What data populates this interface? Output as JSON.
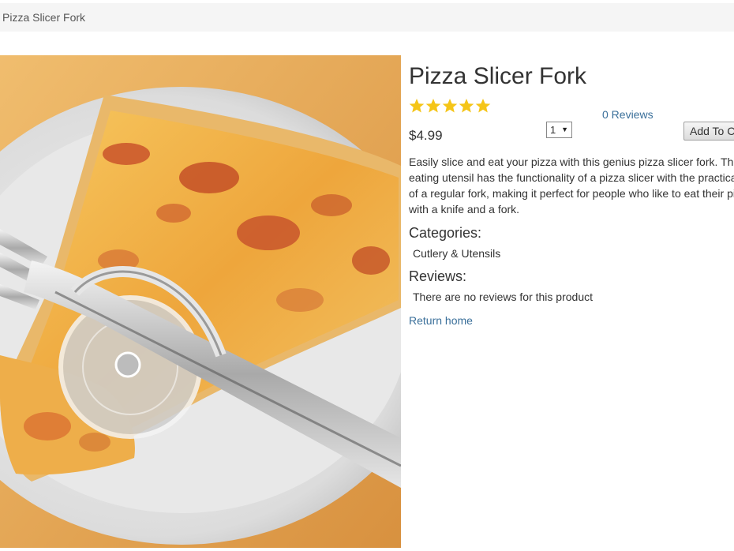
{
  "breadcrumb": {
    "current": "Pizza Slicer Fork"
  },
  "product": {
    "title": "Pizza Slicer Fork",
    "rating": 5,
    "rating_max": 5,
    "star_color": "#f5c518",
    "reviews_link": "0 Reviews",
    "price": "$4.99",
    "quantity": "1",
    "add_to_cart_label": "Add To Cart",
    "description": "Easily slice and eat your pizza with this genius pizza slicer fork. This eating utensil has the functionality of a pizza slicer with the practicality of a regular fork, making it perfect for people who like to eat their pizza with a knife and a fork.",
    "image_alt": "Pizza Slicer Fork"
  },
  "categories": {
    "heading": "Categories:",
    "value": "Cutlery & Utensils"
  },
  "reviews": {
    "heading": "Reviews:",
    "empty_text": "There are no reviews for this product"
  },
  "links": {
    "return_home": "Return home"
  },
  "colors": {
    "link": "#3a6f9a",
    "breadcrumb_bg": "#f5f5f5"
  }
}
